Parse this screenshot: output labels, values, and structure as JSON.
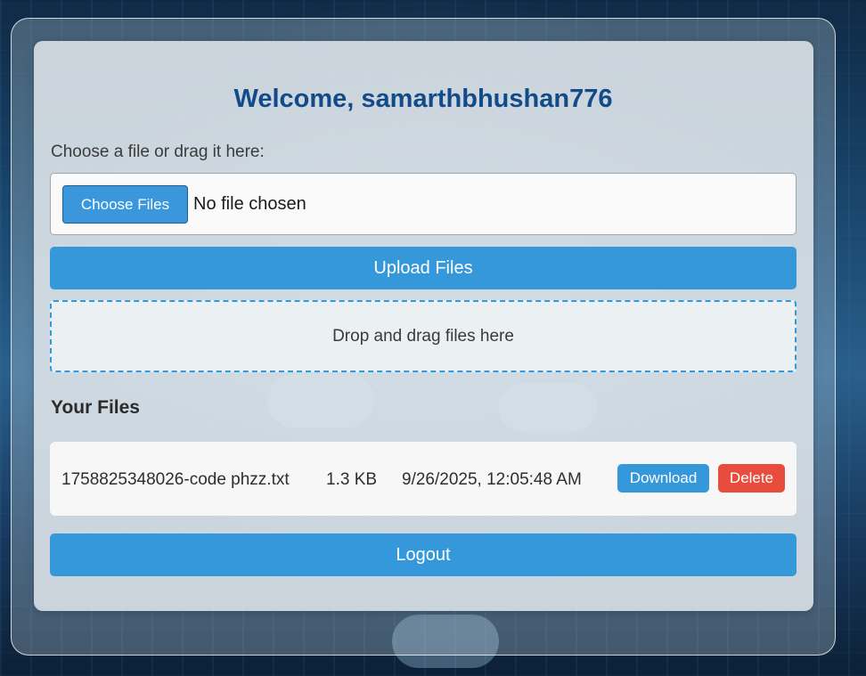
{
  "header": {
    "welcome": "Welcome, samarthbhushan776"
  },
  "upload": {
    "choose_label": "Choose a file or drag it here:",
    "choose_button": "Choose Files",
    "no_file_text": "No file chosen",
    "upload_button": "Upload Files",
    "dropzone_text": "Drop and drag files here"
  },
  "files": {
    "heading": "Your Files",
    "items": [
      {
        "name": "1758825348026-code phzz.txt",
        "size": "1.3 KB",
        "date": "9/26/2025, 12:05:48 AM",
        "download_label": "Download",
        "delete_label": "Delete"
      }
    ]
  },
  "footer": {
    "logout_button": "Logout"
  },
  "colors": {
    "accent": "#3498db",
    "danger": "#e74c3c",
    "title": "#124a8a"
  }
}
